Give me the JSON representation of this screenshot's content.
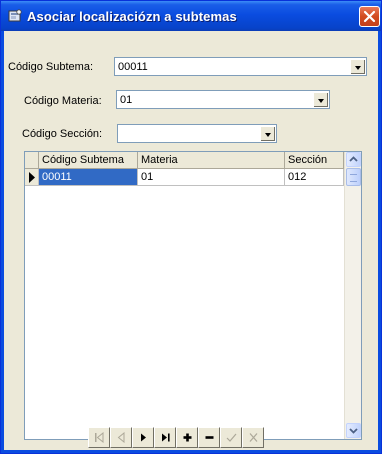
{
  "window": {
    "title": "Asociar localizaciózn a subtemas"
  },
  "fields": {
    "subtema": {
      "label": "Código Subtema:",
      "value": "00011"
    },
    "materia": {
      "label": "Código Materia:",
      "value": "01"
    },
    "seccion": {
      "label": "Código Sección:",
      "value": ""
    }
  },
  "grid": {
    "columns": [
      "Código Subtema",
      "Materia",
      "Sección"
    ],
    "rows": [
      {
        "subtema": "00011",
        "materia": "01",
        "seccion": "012"
      }
    ]
  },
  "navigator": {
    "buttons": [
      {
        "name": "first-record",
        "icon": "first-icon",
        "enabled": false
      },
      {
        "name": "prior-record",
        "icon": "prior-icon",
        "enabled": false
      },
      {
        "name": "next-record",
        "icon": "next-icon",
        "enabled": true
      },
      {
        "name": "last-record",
        "icon": "last-icon",
        "enabled": true
      },
      {
        "name": "insert-record",
        "icon": "plus-icon",
        "enabled": true
      },
      {
        "name": "delete-record",
        "icon": "minus-icon",
        "enabled": true
      },
      {
        "name": "post-edit",
        "icon": "check-icon",
        "enabled": false
      },
      {
        "name": "cancel-edit",
        "icon": "x-icon",
        "enabled": false
      }
    ]
  },
  "colors": {
    "titlebar": "#0a4ce0",
    "selection": "#316ac5",
    "face": "#ece9d8"
  }
}
